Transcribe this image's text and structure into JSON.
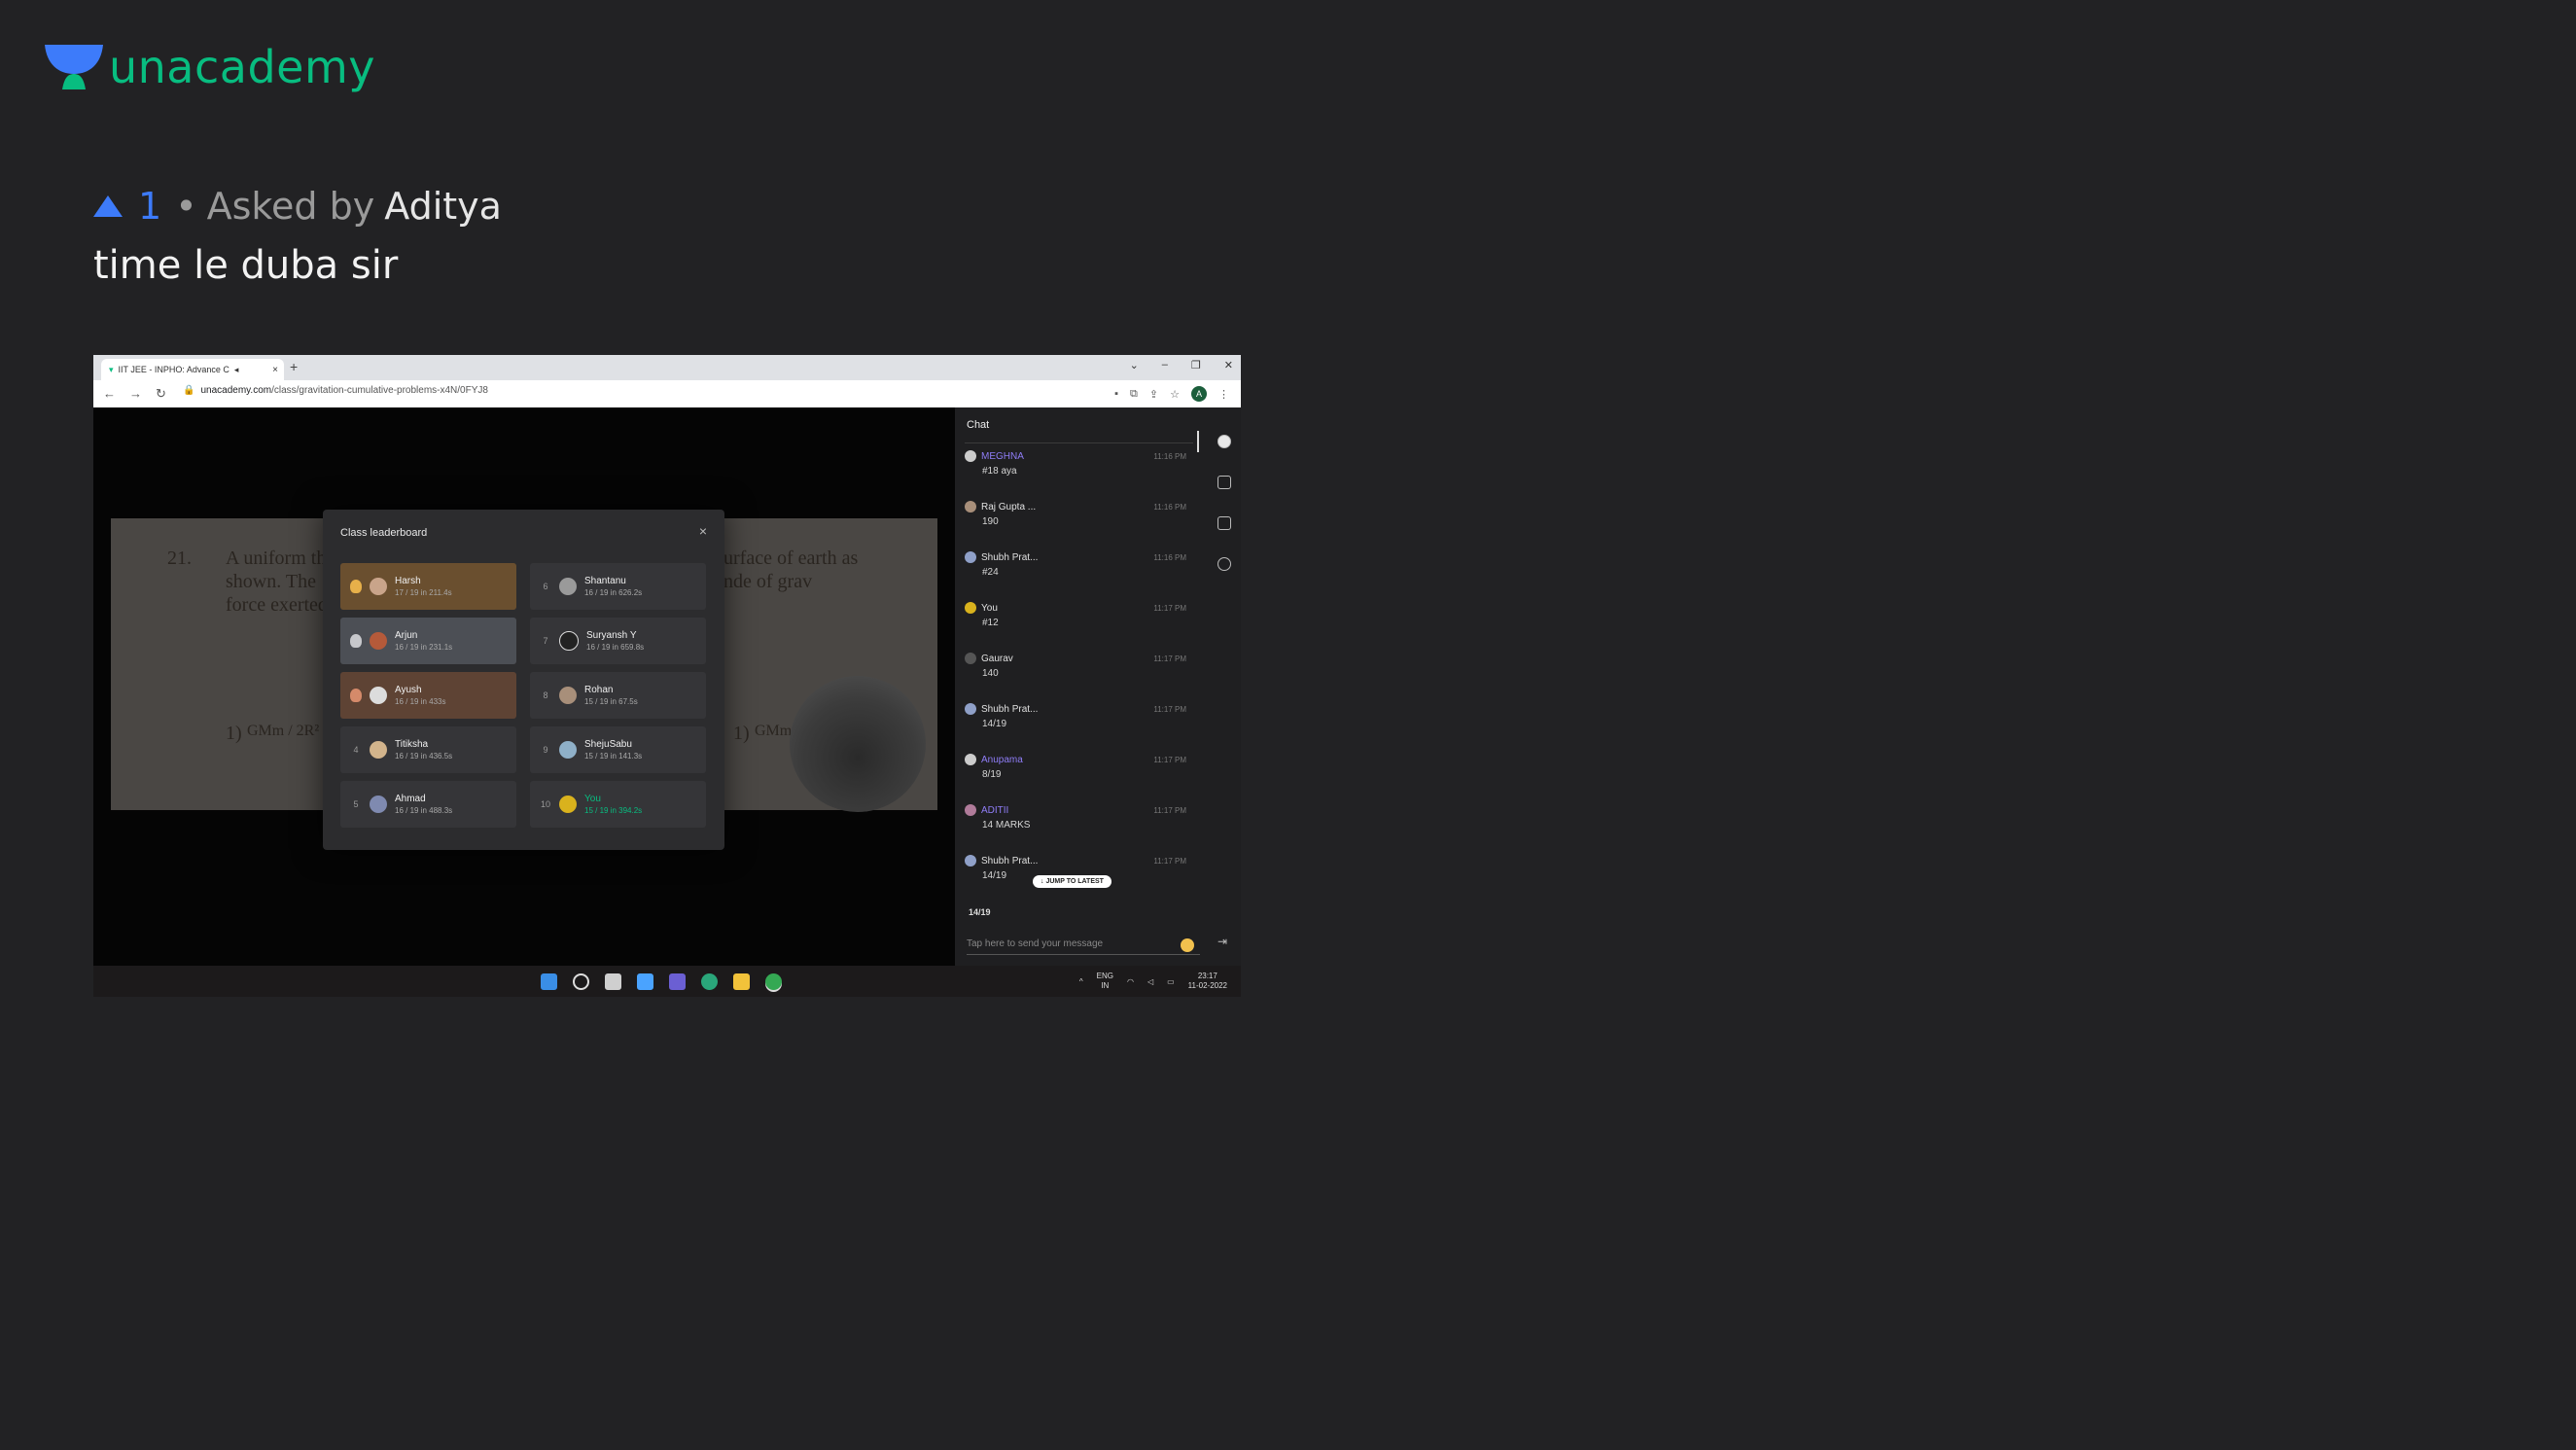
{
  "brand": {
    "name": "unacademy",
    "color": "#08bd80"
  },
  "question": {
    "upvotes": "1",
    "separator": "•",
    "asked_by_prefix": "Asked by",
    "author": "Aditya",
    "text": "time le duba sir"
  },
  "screenshot": {
    "browser": {
      "tab_title": "IIT JEE - INPHO: Advance C",
      "url_host": "unacademy.com",
      "url_path": "/class/gravitation-cumulative-problems-x4N/0FYJ8",
      "profile_initial": "A"
    },
    "board": {
      "q_number": "21.",
      "q_line1": "A uniform th",
      "q_line2": "shown. The",
      "q_line3": "force exerted",
      "right_line1": "urface of earth as",
      "right_line2": "nde of grav",
      "option1_num": "1)",
      "option1_formula": "GMm / 2R²",
      "option2_num": "1)",
      "option2_formula": "GMm / 6R²"
    },
    "leaderboard": {
      "title": "Class leaderboard",
      "close": "×",
      "entries": [
        {
          "rank": "1",
          "name": "Harsh",
          "stats": "17 / 19 in 211.4s"
        },
        {
          "rank": "6",
          "name": "Shantanu",
          "stats": "16 / 19 in 626.2s"
        },
        {
          "rank": "2",
          "name": "Arjun",
          "stats": "16 / 19 in 231.1s"
        },
        {
          "rank": "7",
          "name": "Suryansh Y",
          "stats": "16 / 19 in 659.8s"
        },
        {
          "rank": "3",
          "name": "Ayush",
          "stats": "16 / 19 in 433s"
        },
        {
          "rank": "8",
          "name": "Rohan",
          "stats": "15 / 19 in 67.5s"
        },
        {
          "rank": "4",
          "name": "Titiksha",
          "stats": "16 / 19 in 436.5s"
        },
        {
          "rank": "9",
          "name": "ShejuSabu",
          "stats": "15 / 19 in 141.3s"
        },
        {
          "rank": "5",
          "name": "Ahmad",
          "stats": "16 / 19 in 488.3s"
        },
        {
          "rank": "10",
          "name": "You",
          "stats": "15 / 19 in 394.2s"
        }
      ]
    },
    "chat": {
      "title": "Chat",
      "messages": [
        {
          "name": "MEGHNA",
          "time": "11:16 PM",
          "text": "#18 aya",
          "mentor": true
        },
        {
          "name": "Raj Gupta ...",
          "time": "11:16 PM",
          "text": "190",
          "mentor": false
        },
        {
          "name": "Shubh Prat...",
          "time": "11:16 PM",
          "text": "#24",
          "mentor": false
        },
        {
          "name": "You",
          "time": "11:17 PM",
          "text": "#12",
          "mentor": false
        },
        {
          "name": "Gaurav",
          "time": "11:17 PM",
          "text": "140",
          "mentor": false
        },
        {
          "name": "Shubh Prat...",
          "time": "11:17 PM",
          "text": "14/19",
          "mentor": false
        },
        {
          "name": "Anupama",
          "time": "11:17 PM",
          "text": "8/19",
          "mentor": true
        },
        {
          "name": "ADITII",
          "time": "11:17 PM",
          "text": "14 MARKS",
          "mentor": true
        },
        {
          "name": "Shubh Prat...",
          "time": "11:17 PM",
          "text": "14/19",
          "mentor": false
        }
      ],
      "jump_label": "↓ JUMP TO LATEST",
      "score_line": "14/19",
      "composer_placeholder": "Tap here to send your message"
    },
    "taskbar": {
      "lang_top": "ENG",
      "lang_bottom": "IN",
      "time": "23:17",
      "date": "11-02-2022"
    }
  },
  "colors": {
    "page_bg": "#222224",
    "upvote_blue": "#3d7bfa",
    "mentor_purple": "#8f7df7",
    "self_green": "#08bd80"
  }
}
